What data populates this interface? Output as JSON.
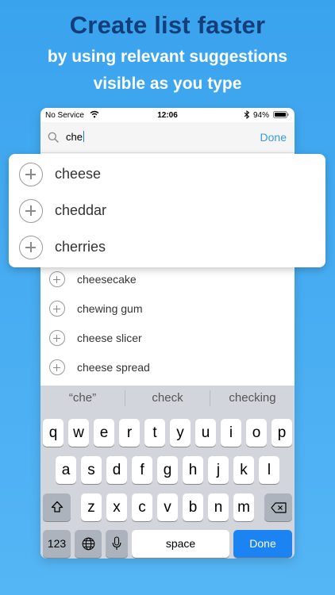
{
  "promo": {
    "headline": "Create list faster",
    "subline1": "by using relevant suggestions",
    "subline2": "visible as you type"
  },
  "status_bar": {
    "carrier": "No Service",
    "time": "12:06",
    "battery": "94%",
    "icons": [
      "wifi-icon",
      "bluetooth-icon",
      "battery-icon"
    ]
  },
  "search": {
    "value": "che",
    "done_label": "Done",
    "icon": "search-icon"
  },
  "highlighted_suggestions": [
    {
      "label": "cheese"
    },
    {
      "label": "cheddar"
    },
    {
      "label": "cherries"
    }
  ],
  "suggestions": [
    {
      "label": "cheesecake"
    },
    {
      "label": "chewing gum"
    },
    {
      "label": "cheese slicer"
    },
    {
      "label": "cheese spread"
    }
  ],
  "keyboard": {
    "predictions": [
      "“che”",
      "check",
      "checking"
    ],
    "row1": [
      "q",
      "w",
      "e",
      "r",
      "t",
      "y",
      "u",
      "i",
      "o",
      "p"
    ],
    "row2": [
      "a",
      "s",
      "d",
      "f",
      "g",
      "h",
      "j",
      "k",
      "l"
    ],
    "row3": [
      "z",
      "x",
      "c",
      "v",
      "b",
      "n",
      "m"
    ],
    "numbers_label": "123",
    "space_label": "space",
    "done_label": "Done"
  },
  "colors": {
    "background_top": "#3aa3ee",
    "headline": "#123f7a",
    "accent": "#3a9ad9",
    "keyboard_done": "#1b84f2"
  }
}
